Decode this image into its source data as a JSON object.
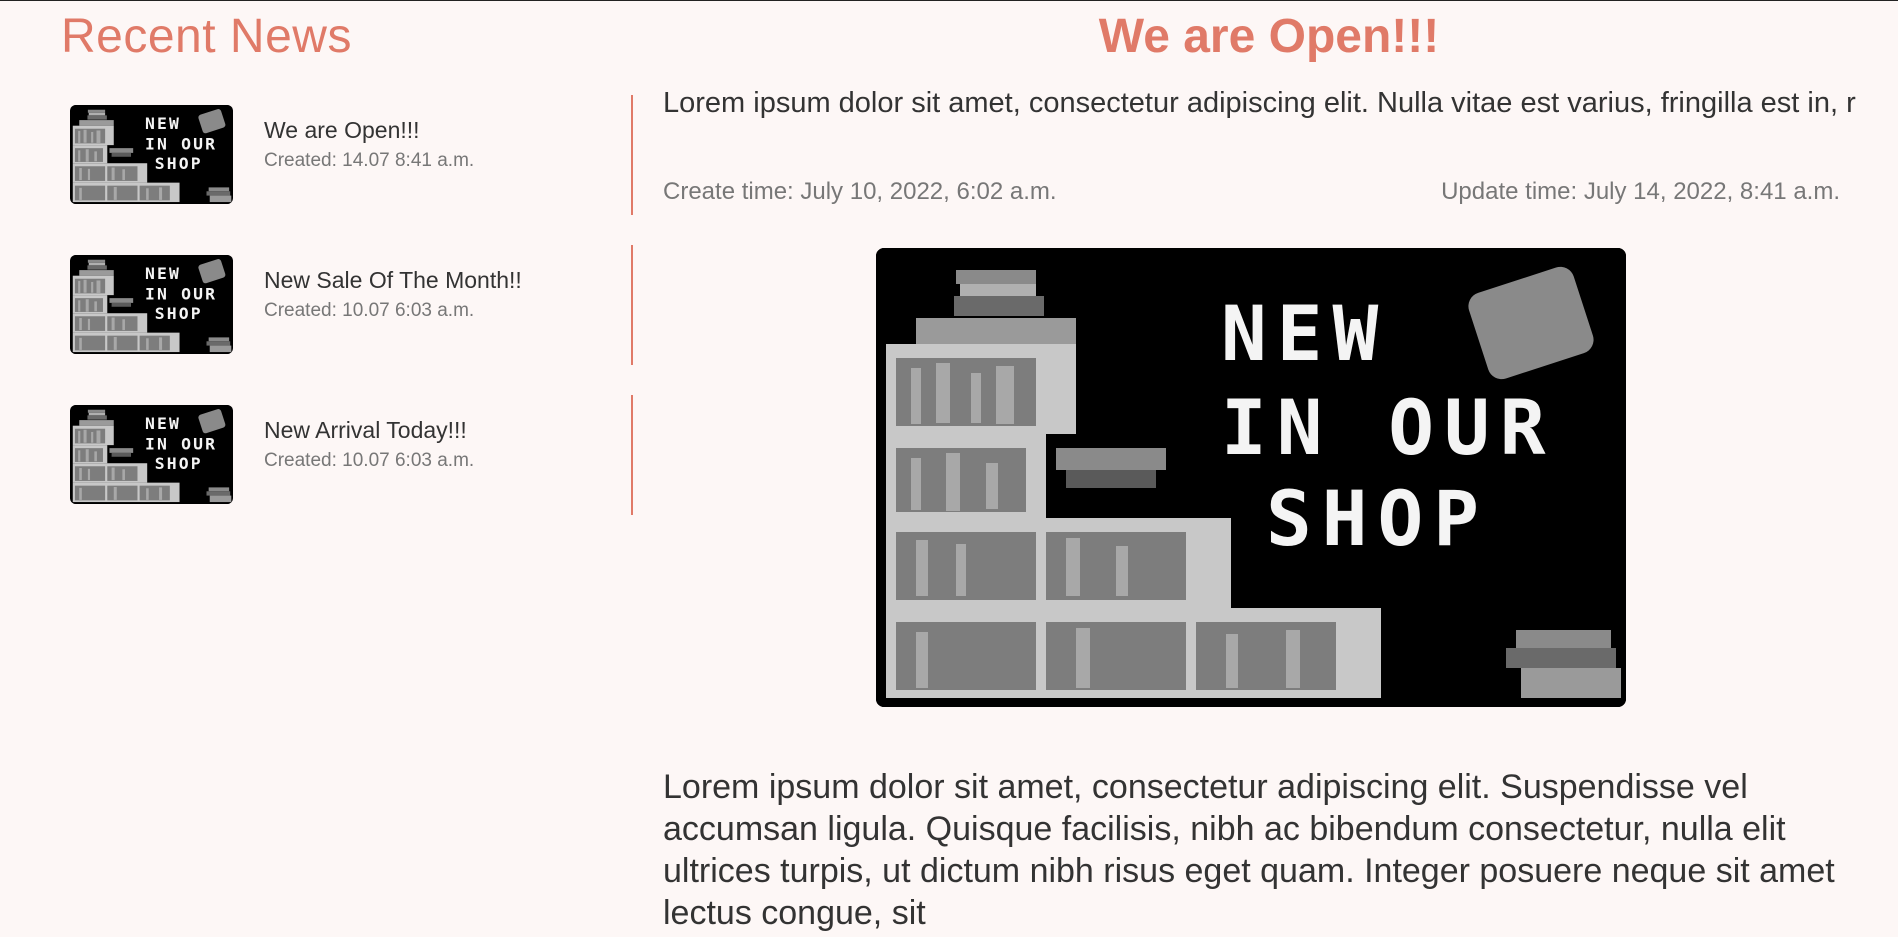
{
  "sidebar": {
    "title": "Recent News",
    "items": [
      {
        "title": "We are Open!!!",
        "created": "Created: 14.07 8:41 a.m."
      },
      {
        "title": "New Sale Of The Month!!",
        "created": "Created: 10.07 6:03 a.m."
      },
      {
        "title": "New Arrival Today!!!",
        "created": "Created: 10.07 6:03 a.m."
      }
    ]
  },
  "article": {
    "title": "We are Open!!!",
    "lead": "Lorem ipsum dolor sit amet, consectetur adipiscing elit. Nulla vitae est varius, fringilla est in, r",
    "create_time": "Create time: July 10, 2022, 6:02 a.m.",
    "update_time": "Update time: July 14, 2022, 8:41 a.m.",
    "image_caption_lines": [
      "NEW",
      "IN OUR",
      "SHOP"
    ],
    "body": "Lorem ipsum dolor sit amet, consectetur adipiscing elit. Suspendisse vel accumsan ligula. Quisque facilisis, nibh ac bibendum consectetur, nulla elit ultrices turpis, ut dictum nibh risus eget quam. Integer posuere neque sit amet lectus congue, sit"
  },
  "colors": {
    "accent": "#e07a68",
    "background": "#fdf7f6"
  }
}
